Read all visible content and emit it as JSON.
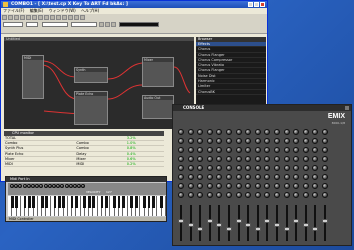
{
  "main_window": {
    "title": "COMBO1 - [ X:\\test.cp X Key To ART Fd bkAs: ]",
    "menu": [
      "ファイル(F)",
      "編集(E)",
      "ウィンドウ(W)",
      "ヘルプ(H)"
    ],
    "graph_title": "Untitled",
    "nodes": [
      "MIDI",
      "Synth",
      "Plate Echo",
      "Mixer",
      "Audio Out"
    ],
    "browser": {
      "header": "Browser",
      "items": [
        "Effects",
        "Chorus",
        "Chorus Flanger",
        "Chorus Compressor",
        "Chorus Vibrato",
        "Chorus Flanger",
        "Noise Dist",
        "Harmonic",
        "Limiter",
        "ChorusBK"
      ]
    },
    "cpu_panel": {
      "header": "CPU monitor",
      "rows": [
        [
          "TOTAL",
          "",
          "3.2%"
        ],
        [
          "Combo",
          "Combo",
          "1.0%"
        ],
        [
          "Synth Plus",
          "Combo",
          "0.8%"
        ],
        [
          "Plate Echo",
          "Delay",
          "0.4%"
        ],
        [
          "Mixer",
          "Mixer",
          "0.6%"
        ],
        [
          "MIDI",
          "MIDI",
          "0.2%"
        ]
      ]
    }
  },
  "mixer_window": {
    "title": "CONSOLE",
    "brand": "EMIX",
    "model": "3000-1/8"
  },
  "keyboard_window": {
    "title": "Midi Port In",
    "status": "MIDI Controller",
    "velocity_label": "VELOCITY",
    "velocity_value": "127"
  }
}
